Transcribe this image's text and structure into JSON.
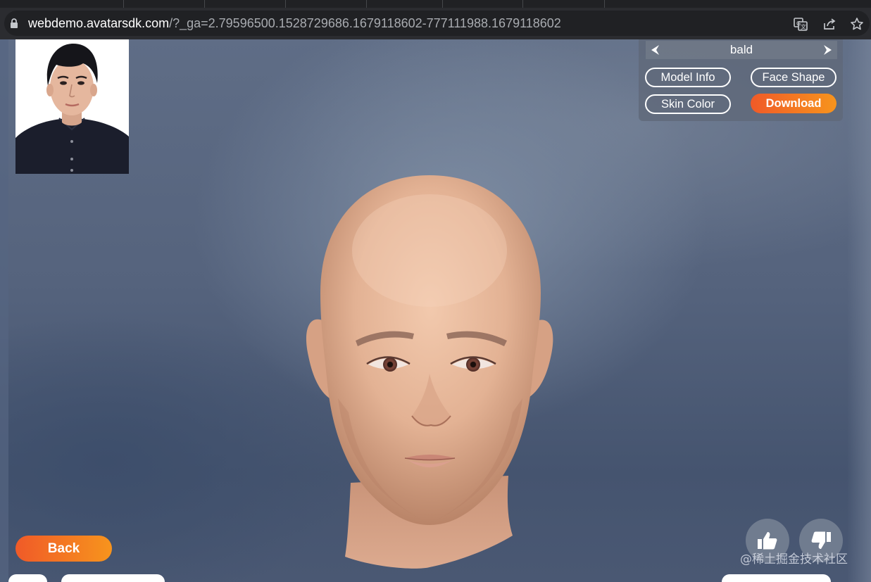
{
  "browser": {
    "url_host": "webdemo.avatarsdk.com",
    "url_path": "/?_ga=2.79596500.1528729686.1679118602-777111988.1679118602"
  },
  "panel": {
    "hair_style": "bald",
    "buttons": {
      "model_info": "Model Info",
      "face_shape": "Face Shape",
      "skin_color": "Skin Color",
      "download": "Download"
    }
  },
  "back_label": "Back",
  "watermark": "@稀土掘金技术社区",
  "colors": {
    "accent_start": "#f05a28",
    "accent_end": "#f7941d"
  }
}
